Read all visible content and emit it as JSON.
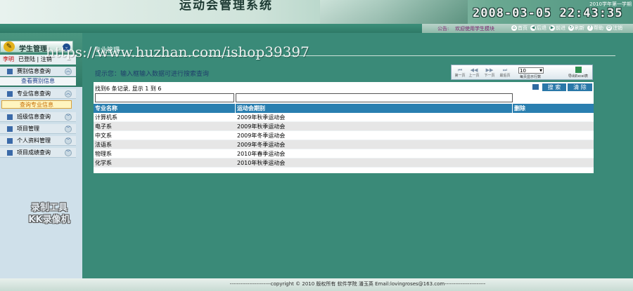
{
  "header": {
    "title": "运动会管理系统",
    "semester": "2010学年第一学期",
    "clock": "2008-03-05 22:43:35"
  },
  "topbar": {
    "notice_label": "公告:",
    "notice_text": "欢迎使用学生模块",
    "toolbar": [
      {
        "label": "首页",
        "icon": "home-icon",
        "glyph": "⌂"
      },
      {
        "label": "后退",
        "icon": "back-icon",
        "glyph": "◀"
      },
      {
        "label": "前进",
        "icon": "forward-icon",
        "glyph": "▶"
      },
      {
        "label": "刷新",
        "icon": "refresh-icon",
        "glyph": "↻"
      },
      {
        "label": "帮助",
        "icon": "help-icon",
        "glyph": "?"
      },
      {
        "label": "注销",
        "icon": "logout-icon",
        "glyph": "⏻"
      }
    ]
  },
  "sidebar": {
    "title": "学生管理",
    "user_role": "李明",
    "user_status": "已登陆",
    "logout_label": "注销",
    "menus": [
      {
        "label": "赛别信息查询",
        "expanded": true,
        "sub": [
          "查看赛别信息"
        ]
      },
      {
        "label": "专业信息查询",
        "expanded": true,
        "sub": [
          "查询专业信息"
        ]
      },
      {
        "label": "班级信息查询",
        "expanded": false,
        "sub": []
      },
      {
        "label": "项目管理",
        "expanded": false,
        "sub": []
      },
      {
        "label": "个人资料管理",
        "expanded": false,
        "sub": []
      },
      {
        "label": "项目成绩查询",
        "expanded": false,
        "sub": []
      }
    ],
    "watermark_line1": "录制工具",
    "watermark_line2": "KK录像机"
  },
  "main": {
    "section_title": "专业管理",
    "hint": "提示您：输入框输入数据可进行搜索查询",
    "url_watermark": "https://www.huzhan.com/ishop39397",
    "pager": {
      "buttons": [
        {
          "label": "第一页",
          "glyph": "⏮"
        },
        {
          "label": "上一页",
          "glyph": "◀◀"
        },
        {
          "label": "下一页",
          "glyph": "▶▶"
        },
        {
          "label": "最后页",
          "glyph": "⏭"
        }
      ],
      "page_size": "10",
      "page_size_label": "每页显示行数",
      "export_label": "导出Excel表"
    },
    "record_count": "找到6 条记录, 显示 1 到 6",
    "search_label": "搜 索",
    "clear_label": "清 除",
    "columns": [
      "专业名称",
      "运动会期别",
      "删除"
    ],
    "rows": [
      [
        "计算机系",
        "2009年秋季运动会",
        ""
      ],
      [
        "电子系",
        "2009年秋季运动会",
        ""
      ],
      [
        "中文系",
        "2009年冬季运动会",
        ""
      ],
      [
        "法语系",
        "2009年冬季运动会",
        ""
      ],
      [
        "物理系",
        "2010年春季运动会",
        ""
      ],
      [
        "化学系",
        "2010年秋季运动会",
        ""
      ]
    ]
  },
  "footer": {
    "text": "-----------------------copyright © 2010 版权所有 软件学院 潘玉英  Email:lovingroses@163.com-----------------------"
  },
  "colors": {
    "main_bg": "#3a8a78",
    "table_header": "#2a7fb0",
    "sidebar_bg": "#cfe0ea"
  }
}
